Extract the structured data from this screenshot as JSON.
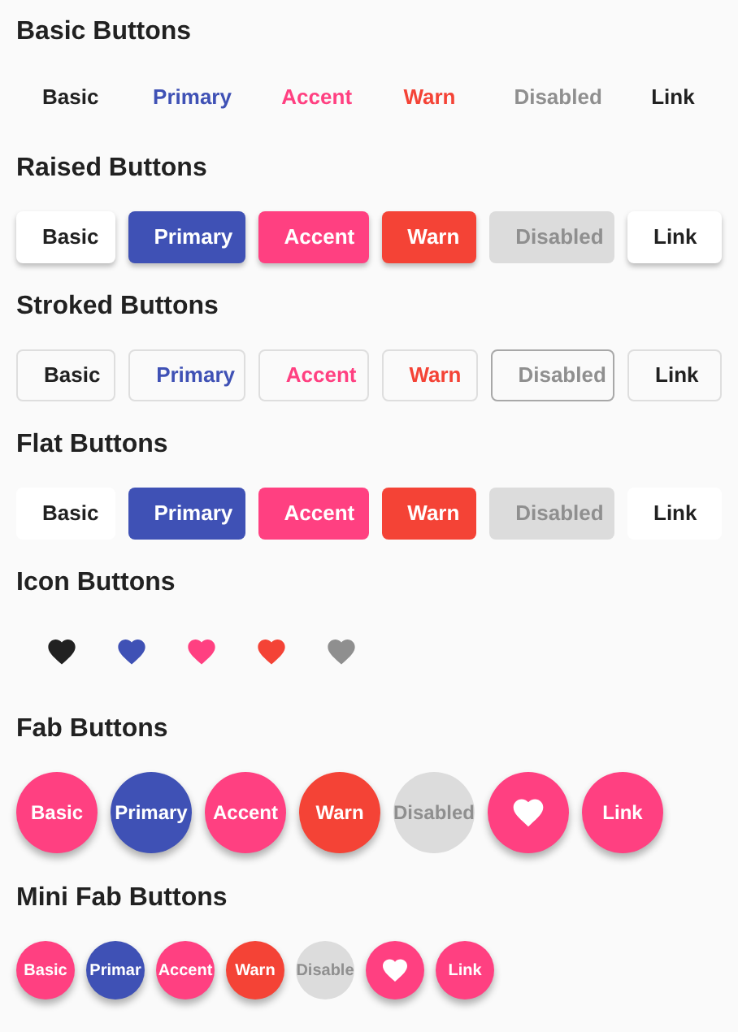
{
  "sections": [
    {
      "title": "Basic Buttons",
      "kind": "basic",
      "buttons": [
        {
          "label": "Basic",
          "color": "#212121",
          "disabled": false
        },
        {
          "label": "Primary",
          "color": "#3f51b5",
          "disabled": false
        },
        {
          "label": "Accent",
          "color": "#ff4081",
          "disabled": false
        },
        {
          "label": "Warn",
          "color": "#f44336",
          "disabled": false
        },
        {
          "label": "Disabled",
          "disabled": true
        },
        {
          "label": "Link",
          "color": "#212121",
          "disabled": false
        }
      ]
    },
    {
      "title": "Raised Buttons",
      "kind": "raised",
      "buttons": [
        {
          "label": "Basic",
          "color": "#ffffff",
          "disabled": false
        },
        {
          "label": "Primary",
          "color": "#3f51b5",
          "disabled": false
        },
        {
          "label": "Accent",
          "color": "#ff4081",
          "disabled": false
        },
        {
          "label": "Warn",
          "color": "#f44336",
          "disabled": false
        },
        {
          "label": "Disabled",
          "disabled": true
        },
        {
          "label": "Link",
          "color": "#ffffff",
          "disabled": false
        }
      ]
    },
    {
      "title": "Stroked Buttons",
      "kind": "stroked",
      "buttons": [
        {
          "label": "Basic",
          "color": "#212121",
          "disabled": false
        },
        {
          "label": "Primary",
          "color": "#3f51b5",
          "disabled": false
        },
        {
          "label": "Accent",
          "color": "#ff4081",
          "disabled": false
        },
        {
          "label": "Warn",
          "color": "#f44336",
          "disabled": false
        },
        {
          "label": "Disabled",
          "disabled": true
        },
        {
          "label": "Link",
          "color": "#212121",
          "disabled": false
        }
      ]
    },
    {
      "title": "Flat Buttons",
      "kind": "flat",
      "buttons": [
        {
          "label": "Basic",
          "color": "#ffffff",
          "disabled": false
        },
        {
          "label": "Primary",
          "color": "#3f51b5",
          "disabled": false
        },
        {
          "label": "Accent",
          "color": "#ff4081",
          "disabled": false
        },
        {
          "label": "Warn",
          "color": "#f44336",
          "disabled": false
        },
        {
          "label": "Disabled",
          "disabled": true
        },
        {
          "label": "Link",
          "color": "#ffffff",
          "disabled": false
        }
      ]
    },
    {
      "title": "Icon Buttons",
      "kind": "icon",
      "buttons": [
        {
          "color": "#212121",
          "disabled": false
        },
        {
          "color": "#3f51b5",
          "disabled": false
        },
        {
          "color": "#ff4081",
          "disabled": false
        },
        {
          "color": "#f44336",
          "disabled": false
        },
        {
          "disabled": true
        }
      ]
    },
    {
      "title": "Fab Buttons",
      "kind": "fab",
      "buttons": [
        {
          "label": "Basic",
          "color": "#ff4081",
          "disabled": false
        },
        {
          "label": "Primary",
          "color": "#3f51b5",
          "disabled": false
        },
        {
          "label": "Accent",
          "color": "#ff4081",
          "disabled": false
        },
        {
          "label": "Warn",
          "color": "#f44336",
          "disabled": false
        },
        {
          "label": "Disabled",
          "disabled": true
        },
        {
          "color": "#ff4081",
          "disabled": false
        },
        {
          "label": "Link",
          "color": "#ff4081",
          "disabled": false
        }
      ]
    },
    {
      "title": "Mini Fab Buttons",
      "kind": "mini-fab",
      "buttons": [
        {
          "label": "Basic",
          "color": "#ff4081",
          "disabled": false
        },
        {
          "label": "Primar",
          "color": "#3f51b5",
          "disabled": false
        },
        {
          "label": "Accent",
          "color": "#ff4081",
          "disabled": false
        },
        {
          "label": "Warn",
          "color": "#f44336",
          "disabled": false
        },
        {
          "label": "Disable",
          "disabled": true
        },
        {
          "color": "#ff4081",
          "disabled": false
        },
        {
          "label": "Link",
          "color": "#ff4081",
          "disabled": false
        }
      ]
    }
  ]
}
